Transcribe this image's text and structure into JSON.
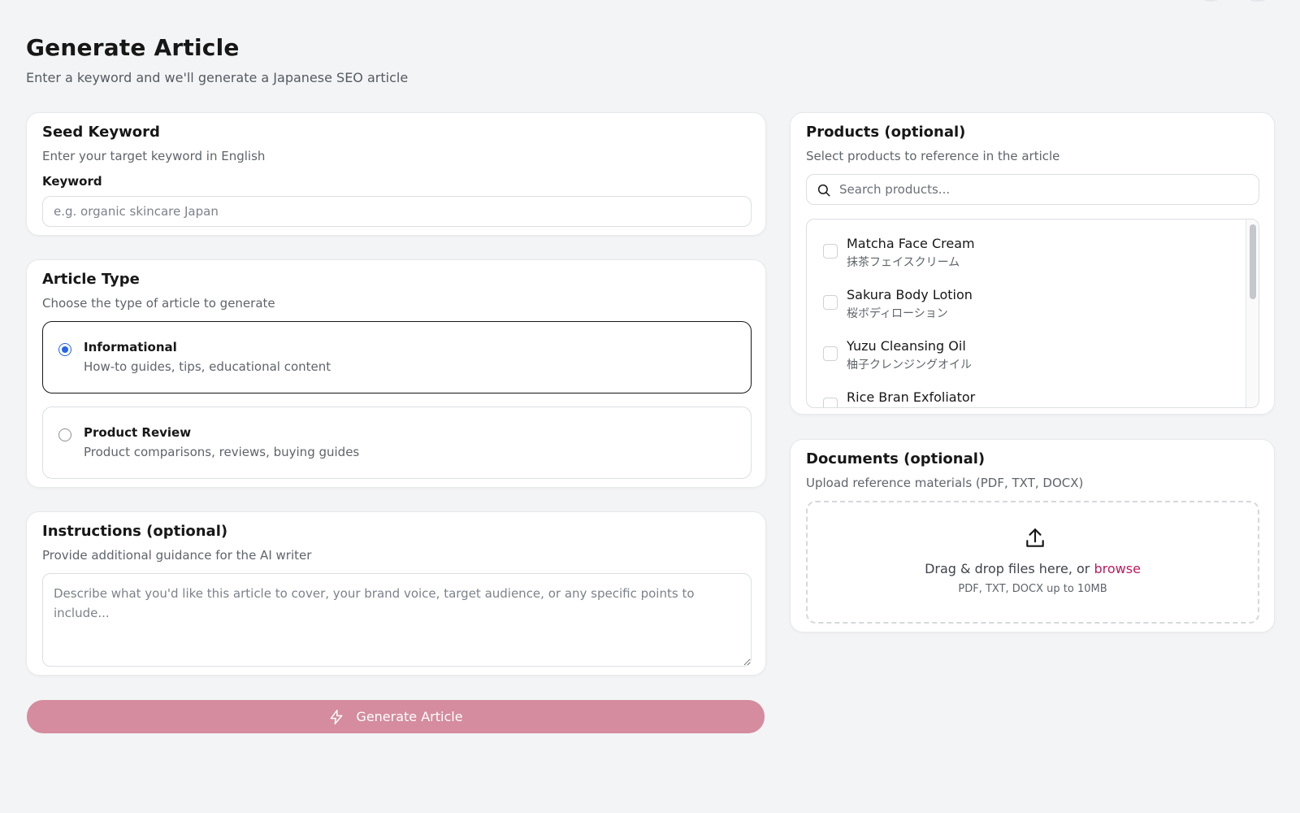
{
  "page": {
    "title": "Generate Article",
    "subtitle": "Enter a keyword and we'll generate a Japanese SEO article"
  },
  "seed_keyword": {
    "title": "Seed Keyword",
    "description": "Enter your target keyword in English",
    "field_label": "Keyword",
    "value": "",
    "placeholder": "e.g. organic skincare Japan"
  },
  "article_type": {
    "title": "Article Type",
    "description": "Choose the type of article to generate",
    "selected": "informational",
    "options": [
      {
        "id": "informational",
        "label": "Informational",
        "description": "How-to guides, tips, educational content"
      },
      {
        "id": "product_review",
        "label": "Product Review",
        "description": "Product comparisons, reviews, buying guides"
      }
    ]
  },
  "instructions": {
    "title": "Instructions (optional)",
    "description": "Provide additional guidance for the AI writer",
    "value": "",
    "placeholder": "Describe what you'd like this article to cover, your brand voice, target audience, or any specific points to include..."
  },
  "generate_button": {
    "label": "Generate Article",
    "icon": "zap-icon",
    "color": "#d48c9e"
  },
  "products": {
    "title": "Products (optional)",
    "description": "Select products to reference in the article",
    "search_placeholder": "Search products...",
    "items": [
      {
        "name": "Matcha Face Cream",
        "name_jp": "抹茶フェイスクリーム",
        "checked": false
      },
      {
        "name": "Sakura Body Lotion",
        "name_jp": "桜ボディローション",
        "checked": false
      },
      {
        "name": "Yuzu Cleansing Oil",
        "name_jp": "柚子クレンジングオイル",
        "checked": false
      },
      {
        "name": "Rice Bran Exfoliator",
        "name_jp": "",
        "checked": false
      }
    ]
  },
  "documents": {
    "title": "Documents (optional)",
    "description": "Upload reference materials (PDF, TXT, DOCX)",
    "drop_text": "Drag & drop files here, or",
    "browse_label": "browse",
    "hint": "PDF, TXT, DOCX up to 10MB",
    "icon": "upload-icon",
    "link_color": "#c2185b"
  },
  "colors": {
    "background": "#f3f4f6",
    "radio_selected": "#2563eb"
  }
}
